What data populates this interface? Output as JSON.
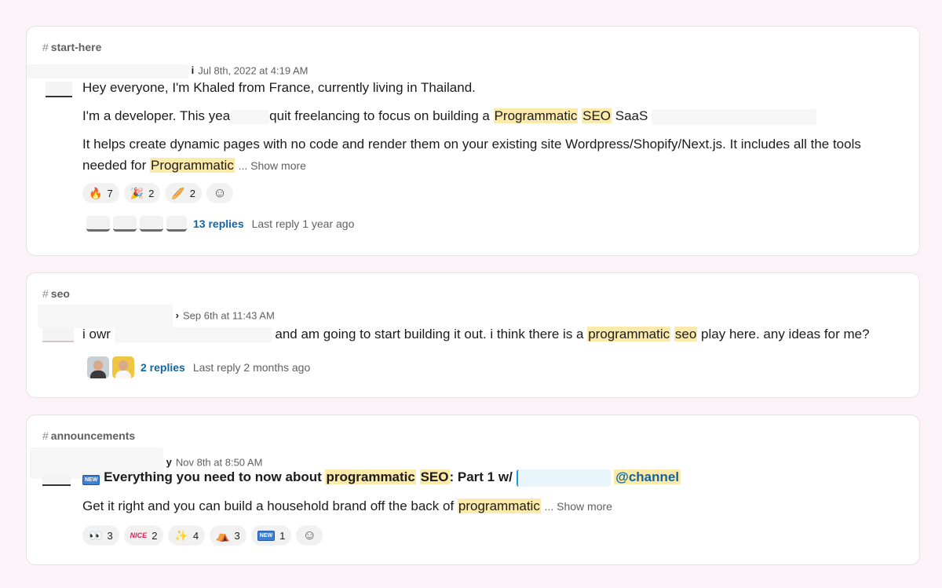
{
  "results": [
    {
      "channel": "start-here",
      "timestamp": "Jul 8th, 2022 at 4:19 AM",
      "name_tail": "i",
      "lines": [
        {
          "text": "Hey everyone, I'm Khaled from France, currently living in Thailand."
        },
        {
          "pre": "I'm a developer. This yea",
          "mid": "quit freelancing to focus on building a ",
          "hl1": "Programmatic",
          "hl2": "SEO",
          "post": "SaaS"
        },
        {
          "text": "It helps create dynamic pages with no code and render them on your existing site Wordpress/Shopify/Next.js. It includes all the tools"
        },
        {
          "pre": "needed for ",
          "hl1": "Programmatic",
          "more": "... Show more"
        }
      ],
      "reactions": [
        {
          "emoji": "🔥",
          "name": "fire-icon",
          "count": "7"
        },
        {
          "emoji": "🎉",
          "name": "party-icon",
          "count": "2"
        },
        {
          "emoji": "🥖",
          "name": "baguette-icon",
          "count": "2"
        }
      ],
      "thread": {
        "replies": "13 replies",
        "last_reply": "Last reply 1 year ago"
      }
    },
    {
      "channel": "seo",
      "timestamp": "Sep 6th at 11:43 AM",
      "name_tail": "›",
      "lines": [
        {
          "pre": "i owr",
          "mid": "and am going to start building it out. i think there is a ",
          "hl1": "programmatic",
          "hl2": "seo",
          "post": "play here. any ideas for me?"
        }
      ],
      "thread": {
        "replies": "2 replies",
        "last_reply": "Last reply 2 months ago"
      }
    },
    {
      "channel": "announcements",
      "timestamp": "Nov 8th at 8:50 AM",
      "name_tail": "y",
      "lines": [
        {
          "badge": "NEW",
          "pre": "Everything you need to now about ",
          "hl1": "programmatic",
          "hl2": "SEO",
          "post": ": Part 1 w/ ",
          "mention": "@channel"
        },
        {
          "pre": "Get it right and you can build a household brand off the back of ",
          "hl1": "programmatic",
          "more": "... Show more"
        }
      ],
      "reactions": [
        {
          "emoji": "👀",
          "name": "eyes-icon",
          "count": "3"
        },
        {
          "emoji": "NICE",
          "name": "nice-icon",
          "count": "2"
        },
        {
          "emoji": "✨",
          "name": "sparkle-icon",
          "count": "4"
        },
        {
          "emoji": "⛺",
          "name": "tent-icon",
          "count": "3"
        },
        {
          "emoji": "NEW",
          "name": "new-icon",
          "count": "1"
        }
      ]
    }
  ],
  "add_reaction_icon": "☺",
  "colors": {
    "highlight": "#fbeaa9",
    "link": "#1264a3",
    "background": "#fbf3f7"
  }
}
